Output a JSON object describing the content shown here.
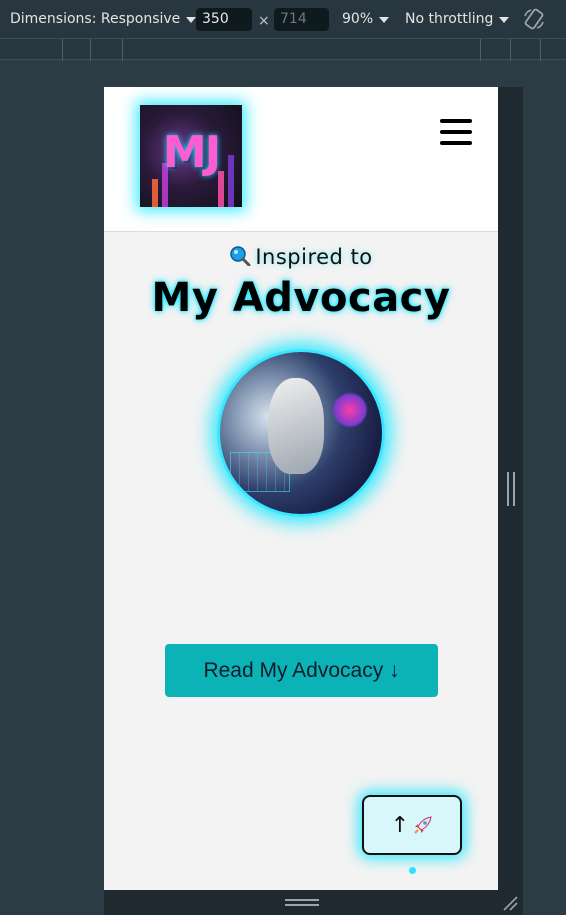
{
  "devtools": {
    "dimensions_label": "Dimensions: Responsive",
    "width_value": "350",
    "times_sign": "×",
    "height_value": "714",
    "zoom_label": "90%",
    "throttling_label": "No throttling",
    "icons": {
      "dimensions_dropdown": "caret-down-icon",
      "zoom_dropdown": "caret-down-icon",
      "throttling_dropdown": "caret-down-icon",
      "rotate": "rotate-icon"
    }
  },
  "site": {
    "logo_text": "MJ",
    "menu_icon": "hamburger-icon",
    "hero": {
      "kicker_icon": "magnifier-icon",
      "kicker": "Inspired to",
      "title": "My Advocacy",
      "avatar_alt": "AI robot portrait"
    },
    "cta_label": "Read My Advocacy ↓",
    "scroll_top_label": "↑",
    "scroll_top_icon": "rocket-icon"
  },
  "colors": {
    "accent_glow": "#00e6ff",
    "cta_bg": "#0bb3b6",
    "scroll_top_bg": "#d8f7fa"
  }
}
